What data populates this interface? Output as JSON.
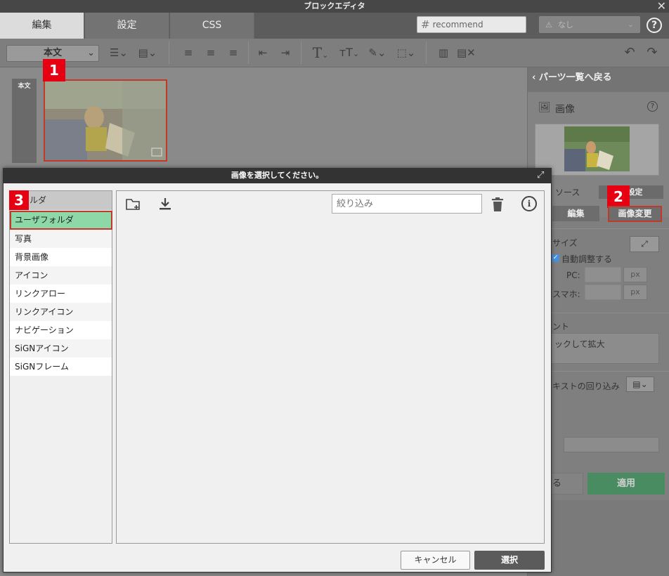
{
  "window": {
    "title": "ブロックエディタ",
    "close_glyph": "✕"
  },
  "header": {
    "tabs": [
      {
        "label": "編集"
      },
      {
        "label": "設定"
      },
      {
        "label": "CSS"
      }
    ],
    "id_field": {
      "hash": "#",
      "value": "recommend"
    },
    "class_select": {
      "value": "なし"
    },
    "help": "?"
  },
  "toolbar": {
    "block_style": "本文",
    "chevron": "⌄"
  },
  "canvas": {
    "body_block_label": "本文",
    "badges": [
      "1",
      "2",
      "3"
    ]
  },
  "right_panel": {
    "back_label": "パーツ一覧へ戻る",
    "part_title": "画像",
    "part_help": "?",
    "source_label": "ソース",
    "link_tab_label": "ク設定",
    "edit_button": "編集",
    "change_image_button": "画像変更",
    "size_label": "サイズ",
    "auto_adjust_label": "自動調整する",
    "pc_label": "PC:",
    "phone_label": "スマホ:",
    "unit": "px",
    "caption_label": "ント",
    "caption_value": "ックして拡大",
    "wrap_label": "キストの回り込み",
    "cancel_partial": "る",
    "apply_button": "適用"
  },
  "dialog": {
    "title": "画像を選択してください。",
    "folder_header": "ルダ",
    "folders": [
      {
        "label": "ユーザフォルダ",
        "selected": true
      },
      {
        "label": "写真"
      },
      {
        "label": "背景画像"
      },
      {
        "label": "アイコン"
      },
      {
        "label": "リンクアロー"
      },
      {
        "label": "リンクアイコン"
      },
      {
        "label": "ナビゲーション"
      },
      {
        "label": "SiGNアイコン"
      },
      {
        "label": "SiGNフレーム"
      }
    ],
    "filter_placeholder": "絞り込み",
    "cancel_button": "キャンセル",
    "select_button": "選択"
  },
  "colors": {
    "accent_red": "#e60012",
    "selected_folder": "#8ed8a8",
    "apply_green": "#4a8c62"
  }
}
